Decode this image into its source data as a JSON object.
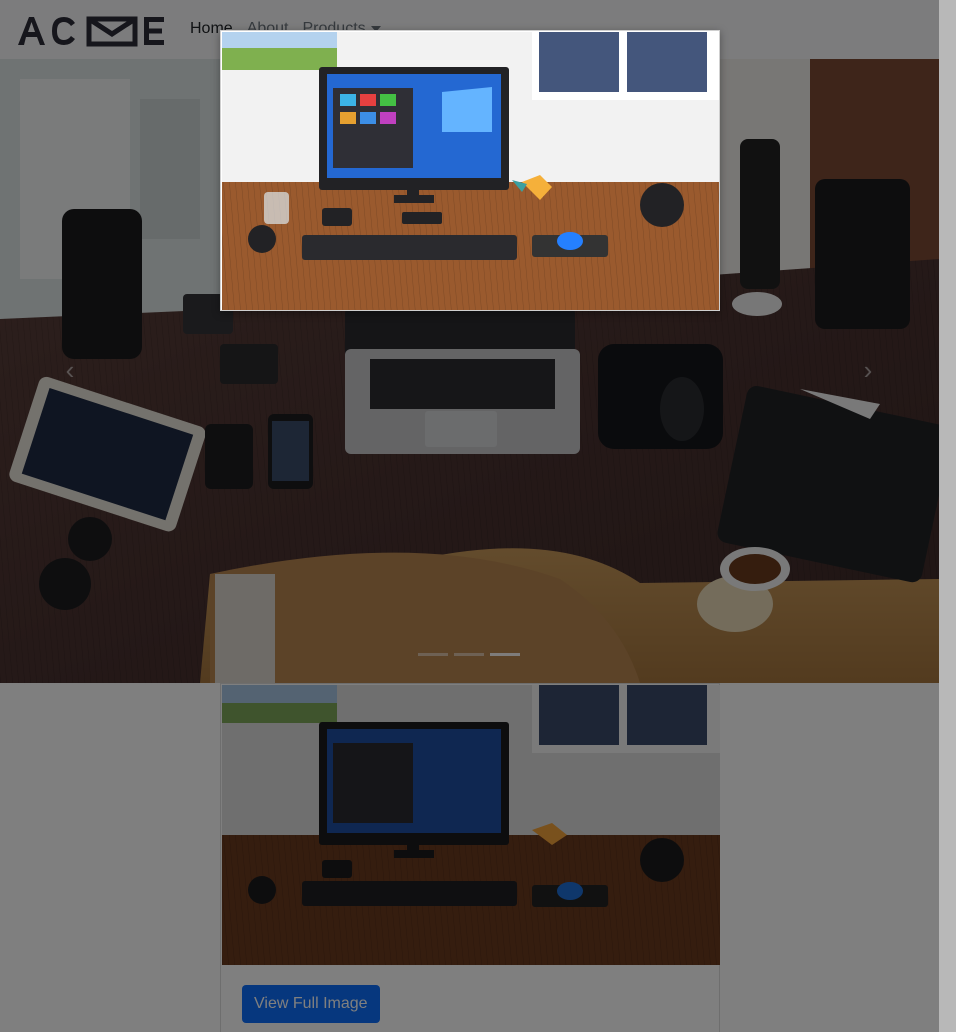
{
  "brand": {
    "logo_text": "ACME"
  },
  "nav": {
    "home_label": "Home",
    "about_label": "About",
    "products_label": "Products",
    "products_icon": "caret-down-icon"
  },
  "carousel": {
    "prev_icon": "chevron-left-icon",
    "next_icon": "chevron-right-icon",
    "prev_glyph": "‹",
    "next_glyph": "›",
    "slides_count": 3,
    "active_slide": 3
  },
  "card": {
    "button_label": "View Full Image"
  },
  "modal": {
    "image_subject": "desk-with-monitor-photo"
  },
  "colors": {
    "accent": "#0d6efd",
    "overlay": "#000000",
    "navbar_bg": "#f8f9fa"
  }
}
